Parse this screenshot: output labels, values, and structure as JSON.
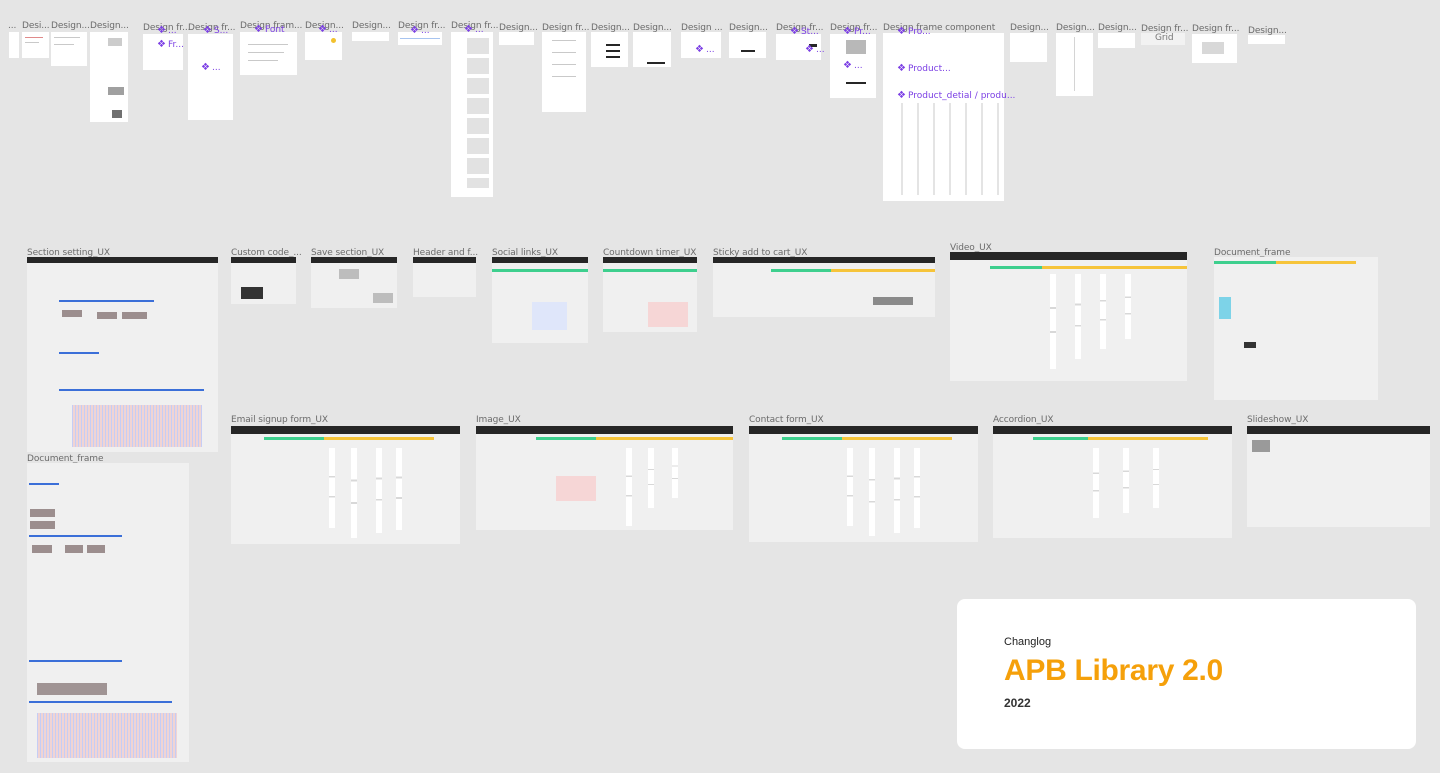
{
  "canvas": {
    "background": "#e5e5e5",
    "top_row_labels": [
      "...",
      "Desi...",
      "Design...",
      "Design...",
      "Design fr...",
      "Design fr...",
      "Design fram...",
      "Design...",
      "Design...",
      "Design fr...",
      "Design fr...",
      "Design...",
      "Design fr...",
      "Design...",
      "Design...",
      "Design ...",
      "Design...",
      "Design fr...",
      "Design fr...",
      "Design frame component",
      "Design...",
      "Design...",
      "Design...",
      "Design fr...",
      "Design fr...",
      "Design..."
    ],
    "components": {
      "c1": "...",
      "c2": "Fr...",
      "c3": "S...",
      "c4": "Font",
      "c5": "...",
      "c6": "...",
      "c7": "...",
      "c8": "...",
      "c9": "St...",
      "c10": "Pr...",
      "c11": "Pro...",
      "c12": "Product...",
      "c13": "Product_detial / produ...",
      "c14": "...",
      "c15": "...",
      "c16": "..."
    },
    "grid_label": "Grid",
    "section_labels": {
      "section_setting": "Section setting_UX",
      "custom_code": "Custom code_...",
      "save_section": "Save section_UX",
      "header_footer": "Header and f...",
      "social_links": "Social links_UX",
      "countdown": "Countdown timer_UX",
      "sticky_cart": "Sticky add to cart_UX",
      "video": "Video_UX",
      "document_frame_right": "Document_frame",
      "document_frame_left": "Document_frame",
      "email_signup": "Email signup form_UX",
      "image": "Image_UX",
      "contact_form": "Contact form_UX",
      "accordion": "Accordion_UX",
      "slideshow": "Slideshow_UX"
    },
    "accent_colors": {
      "component": "#7b3fe4",
      "green": "#3ecf8e",
      "yellow": "#f6c43a",
      "blue": "#3b6fd8"
    }
  },
  "changelog": {
    "subtitle": "Changlog",
    "title": "APB Library 2.0",
    "year": "2022",
    "title_color": "#f5a00a"
  }
}
